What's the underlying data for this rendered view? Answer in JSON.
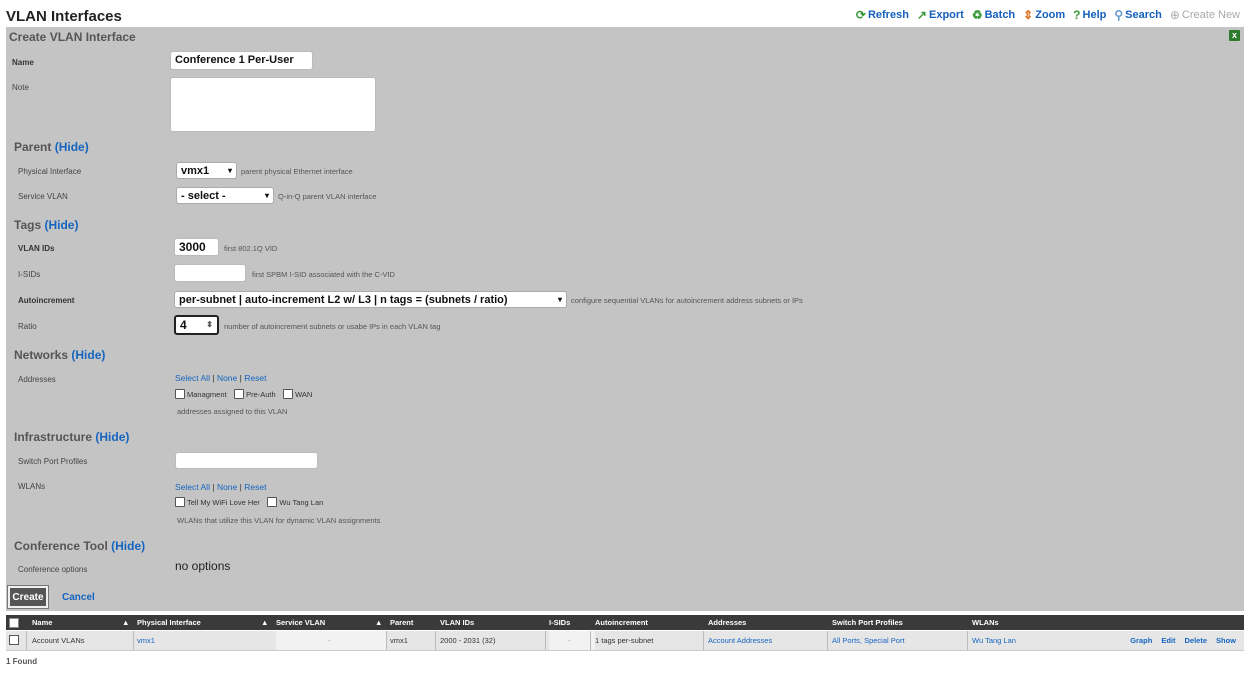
{
  "page": {
    "title": "VLAN Interfaces"
  },
  "toolbar": {
    "refresh": "Refresh",
    "export": "Export",
    "batch": "Batch",
    "zoom": "Zoom",
    "help": "Help",
    "search": "Search",
    "create_new": "Create New"
  },
  "form": {
    "title": "Create VLAN Interface",
    "close_glyph": "x",
    "name_label": "Name",
    "name_value": "Conference 1 Per-User",
    "note_label": "Note",
    "parent_section": "Parent",
    "parent_toggle": "(Hide)",
    "physical_label": "Physical Interface",
    "physical_value": "vmx1",
    "physical_help": "parent physical Ethernet interface",
    "service_label": "Service VLAN",
    "service_value": "- select -",
    "service_help": "Q-in-Q parent VLAN interface",
    "tags_section": "Tags",
    "tags_toggle": "(Hide)",
    "vlan_ids_label": "VLAN IDs",
    "vlan_ids_value": "3000",
    "vlan_ids_help": "first 802.1Q VID",
    "isids_label": "I-SIDs",
    "isids_help": "first SPBM I-SID associated with the C-VID",
    "autoinc_label": "Autoincrement",
    "autoinc_value": "per-subnet | auto-increment L2 w/ L3 | n tags = (subnets / ratio)",
    "autoinc_help": "configure sequential VLANs for autoincrement address subnets or IPs",
    "ratio_label": "Ratio",
    "ratio_value": "4",
    "ratio_help": "number of autoincrement subnets or usabe IPs in each VLAN tag",
    "networks_section": "Networks",
    "networks_toggle": "(Hide)",
    "addresses_label": "Addresses",
    "select_all": "Select All",
    "none": "None",
    "reset": "Reset",
    "sep": "|",
    "addr_opts": [
      "Managment",
      "Pre-Auth",
      "WAN"
    ],
    "addresses_help": "addresses assigned to this VLAN",
    "infra_section": "Infrastructure",
    "infra_toggle": "(Hide)",
    "spp_label": "Switch Port Profiles",
    "wlans_label": "WLANs",
    "wlan_opts": [
      "Tell My WiFi Love Her",
      "Wu Tang Lan"
    ],
    "wlans_help": "WLANs that utilize this VLAN for dynamic VLAN assignments",
    "conf_section": "Conference Tool",
    "conf_toggle": "(Hide)",
    "conf_label": "Conference options",
    "conf_value": "no options",
    "create_btn": "Create",
    "cancel_btn": "Cancel"
  },
  "table": {
    "headers": [
      "Name",
      "Physical Interface",
      "Service VLAN",
      "Parent",
      "VLAN IDs",
      "I-SIDs",
      "Autoincrement",
      "Addresses",
      "Switch Port Profiles",
      "WLANs"
    ],
    "sort_glyph": "▲",
    "row": {
      "name": "Account VLANs",
      "physical": "vmx1",
      "service": "-",
      "parent": "vmx1",
      "vlan_ids": "2000 - 2031 (32)",
      "isids": "-",
      "autoinc": "1 tags per-subnet",
      "addresses": "Account Addresses",
      "spp": "All Ports, Special Port",
      "wlans": "Wu Tang Lan",
      "actions": [
        "Graph",
        "Edit",
        "Delete",
        "Show"
      ]
    },
    "found": "1 Found"
  }
}
